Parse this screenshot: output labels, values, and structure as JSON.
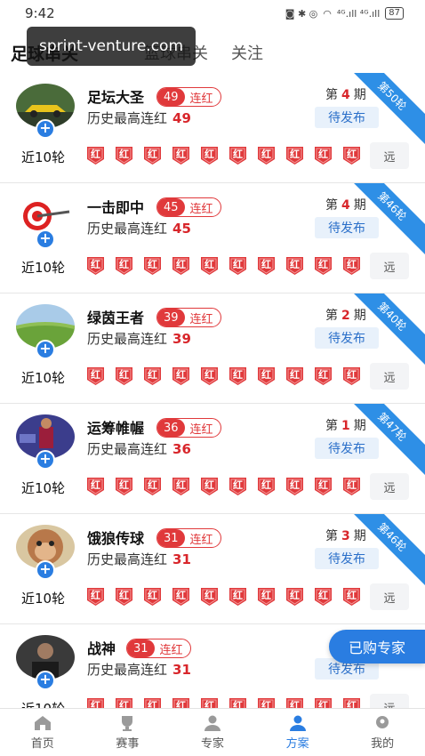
{
  "status": {
    "time": "9:42",
    "network": "⁴ᴳ.ıll ⁴ᴳ.ıll",
    "battery": "87"
  },
  "watermark": "sprint-venture.com",
  "tabs": [
    {
      "label": "足球串关",
      "active": true
    },
    {
      "label": "篮球串关",
      "active": false
    },
    {
      "label": "关注",
      "active": false
    }
  ],
  "labels": {
    "streak_suffix": "连红",
    "best_prefix": "历史最高连红",
    "period_prefix": "第",
    "period_suffix": "期",
    "pending": "待发布",
    "recent": "近10轮",
    "far": "远",
    "result_red": "红"
  },
  "cards": [
    {
      "name": "足坛大圣",
      "streak": "49",
      "best": "49",
      "period": "4",
      "round": "第50轮",
      "avatar": "car-icon"
    },
    {
      "name": "一击即中",
      "streak": "45",
      "best": "45",
      "period": "4",
      "round": "第46轮",
      "avatar": "target-icon"
    },
    {
      "name": "绿茵王者",
      "streak": "39",
      "best": "39",
      "period": "2",
      "round": "第40轮",
      "avatar": "grass-icon"
    },
    {
      "name": "运筹帷幄",
      "streak": "36",
      "best": "36",
      "period": "1",
      "round": "第47轮",
      "avatar": "player-icon"
    },
    {
      "name": "饿狼传球",
      "streak": "31",
      "best": "31",
      "period": "3",
      "round": "第46轮",
      "avatar": "monkey-icon"
    },
    {
      "name": "战神",
      "streak": "31",
      "best": "31",
      "period": "",
      "round": "",
      "avatar": "person-icon"
    }
  ],
  "float_button": "已购专家",
  "bottom_nav": [
    {
      "label": "首页",
      "icon": "home-icon",
      "active": false
    },
    {
      "label": "赛事",
      "icon": "trophy-icon",
      "active": false
    },
    {
      "label": "专家",
      "icon": "expert-icon",
      "active": false
    },
    {
      "label": "方案",
      "icon": "plan-icon",
      "active": true
    },
    {
      "label": "我的",
      "icon": "profile-icon",
      "active": false
    }
  ],
  "colors": {
    "accent": "#2a7de1",
    "red": "#e0393b",
    "ribbon": "#2e8fe6"
  }
}
